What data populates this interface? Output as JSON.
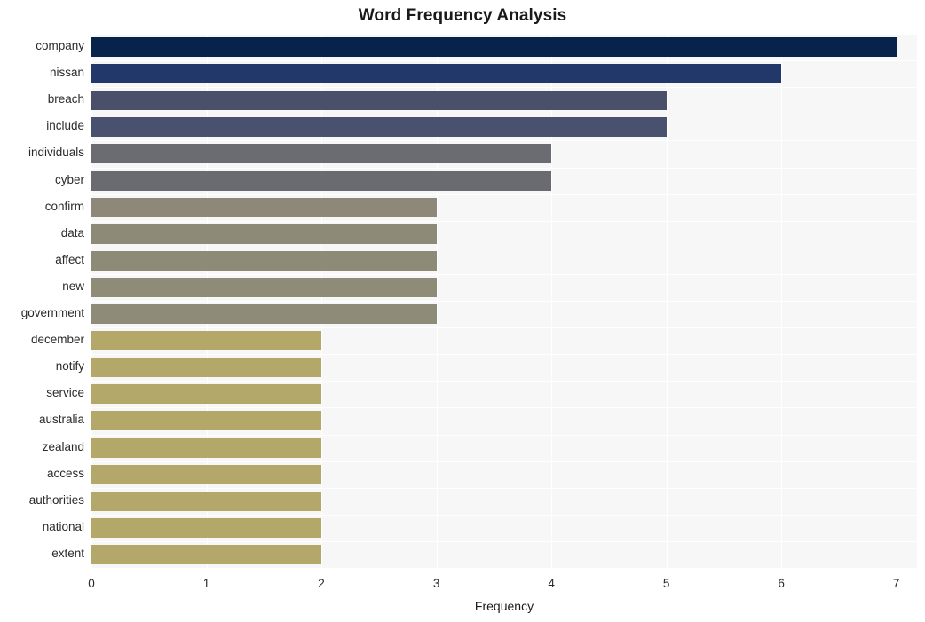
{
  "chart_data": {
    "type": "bar",
    "orientation": "horizontal",
    "title": "Word Frequency Analysis",
    "xlabel": "Frequency",
    "ylabel": "",
    "xlim": [
      0,
      7.18
    ],
    "xticks": [
      "0",
      "1",
      "2",
      "3",
      "4",
      "5",
      "6",
      "7"
    ],
    "xtick_values": [
      0,
      1,
      2,
      3,
      4,
      5,
      6,
      7
    ],
    "grid": true,
    "legend": false,
    "categories": [
      "company",
      "nissan",
      "breach",
      "include",
      "individuals",
      "cyber",
      "confirm",
      "data",
      "affect",
      "new",
      "government",
      "december",
      "notify",
      "service",
      "australia",
      "zealand",
      "access",
      "authorities",
      "national",
      "extent"
    ],
    "values": [
      7,
      6,
      5,
      5,
      4,
      4,
      3,
      3,
      3,
      3,
      3,
      2,
      2,
      2,
      2,
      2,
      2,
      2,
      2,
      2
    ],
    "bar_colors": [
      "#07224b",
      "#22386b",
      "#4a5069",
      "#48526e",
      "#6a6c72",
      "#696b71",
      "#8d8877",
      "#8d8a78",
      "#8e8a78",
      "#8e8b78",
      "#8e8b78",
      "#b3a86a",
      "#b3a86a",
      "#b3a86a",
      "#b3a86a",
      "#b3a86a",
      "#b3a86a",
      "#b3a86a",
      "#b3a86a",
      "#b3a86a"
    ]
  },
  "style": {
    "figure_background": "#ffffff",
    "plot_background": "#f7f7f7",
    "grid_color": "#ffffff",
    "text_color": "#2a2a2a",
    "title_color": "#1a1a1a"
  }
}
